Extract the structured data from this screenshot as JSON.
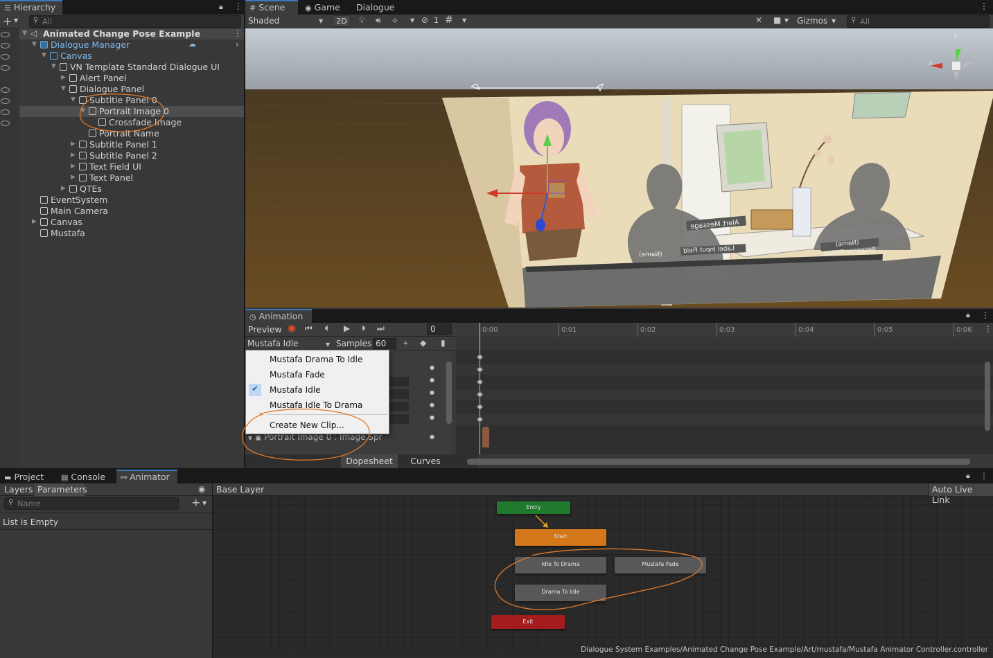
{
  "hierarchy": {
    "tab": "Hierarchy",
    "search_placeholder": "All",
    "scene_name": "Animated Change Pose Example",
    "items": [
      {
        "label": "Dialogue Manager"
      },
      {
        "label": "Canvas"
      },
      {
        "label": "VN Template Standard Dialogue UI"
      },
      {
        "label": "Alert Panel"
      },
      {
        "label": "Dialogue Panel"
      },
      {
        "label": "Subtitle Panel 0"
      },
      {
        "label": "Portrait Image 0"
      },
      {
        "label": "Crossfade Image"
      },
      {
        "label": "Portrait Name"
      },
      {
        "label": "Subtitle Panel 1"
      },
      {
        "label": "Subtitle Panel 2"
      },
      {
        "label": "Text Field UI"
      },
      {
        "label": "Text Panel"
      },
      {
        "label": "QTEs"
      },
      {
        "label": "EventSystem"
      },
      {
        "label": "Main Camera"
      },
      {
        "label": "Canvas"
      },
      {
        "label": "Mustafa"
      }
    ]
  },
  "scene": {
    "tabs": [
      "Scene",
      "Game",
      "Dialogue"
    ],
    "shading": "Shaded",
    "mode_2d": "2D",
    "hidden_count": "1",
    "gizmos": "Gizmos",
    "search_placeholder": "All",
    "axis_x": "x",
    "axis_y": "y",
    "labels": {
      "alert_message": "Alert Message",
      "name_left": "(Name)",
      "name_right": "(Name)",
      "label_input": "Label Input Field",
      "response_button": "Response Button"
    }
  },
  "animation": {
    "tab": "Animation",
    "preview": "Preview",
    "frame": "0",
    "clip": "Mustafa Idle",
    "samples_label": "Samples",
    "samples_value": "60",
    "ticks": [
      "0:00",
      "0:01",
      "0:02",
      "0:03",
      "0:04",
      "0:05",
      "0:06"
    ],
    "property": "Portrait Image 0 : Image.Spr",
    "dopesheet": "Dopesheet",
    "curves": "Curves",
    "dropdown": {
      "items": [
        "Mustafa Drama To Idle",
        "Mustafa Fade",
        "Mustafa Idle",
        "Mustafa Idle To Drama"
      ],
      "checked": "Mustafa Idle",
      "create": "Create New Clip..."
    }
  },
  "bottom": {
    "tabs": [
      "Project",
      "Console",
      "Animator"
    ],
    "layers": "Layers",
    "parameters": "Parameters",
    "name_placeholder": "Name",
    "empty": "List is Empty",
    "breadcrumb": "Base Layer",
    "auto_live_link": "Auto Live Link",
    "states": {
      "entry": "Entry",
      "start": "Start",
      "idle_to_drama": "Idle To Drama",
      "mustafa_fade": "Mustafa Fade",
      "drama_to_idle": "Drama To Idle",
      "exit": "Exit"
    },
    "path": "Dialogue System Examples/Animated Change Pose Example/Art/mustafa/Mustafa Animator Controller.controller"
  },
  "colors": {
    "accent": "#3a79bb",
    "entry": "#1f7a2e",
    "start": "#d4761a",
    "exit": "#a41c1c",
    "annotation": "#e07a2a"
  }
}
